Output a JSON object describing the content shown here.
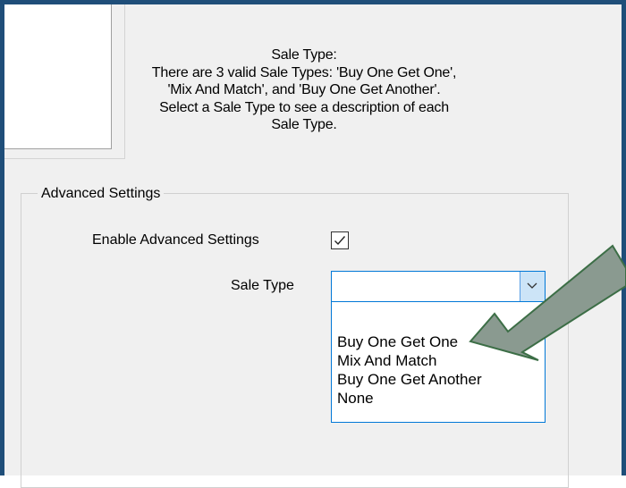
{
  "description": {
    "lines": [
      "Sale Type:",
      "There are 3 valid Sale Types: 'Buy One Get One',",
      "'Mix And Match', and 'Buy One Get Another'.",
      "Select a Sale Type to see a description of each",
      "Sale Type."
    ]
  },
  "advanced_settings": {
    "group_title": "Advanced Settings",
    "enable_label": "Enable Advanced Settings",
    "enable_checked": true,
    "sale_type_label": "Sale Type",
    "sale_type_value": "",
    "options": [
      "Buy One Get One",
      "Mix And Match",
      "Buy One Get Another",
      "None"
    ]
  },
  "colors": {
    "frame_border": "#1f4e79",
    "combo_accent": "#0078d7",
    "combo_button_bg": "#cce4f7",
    "arrow_fill": "#8a9a90",
    "arrow_stroke": "#3c6e46"
  },
  "icons": {
    "checkbox": "checkmark-icon",
    "dropdown": "chevron-down-icon",
    "annotation": "arrow-pointer-icon"
  }
}
